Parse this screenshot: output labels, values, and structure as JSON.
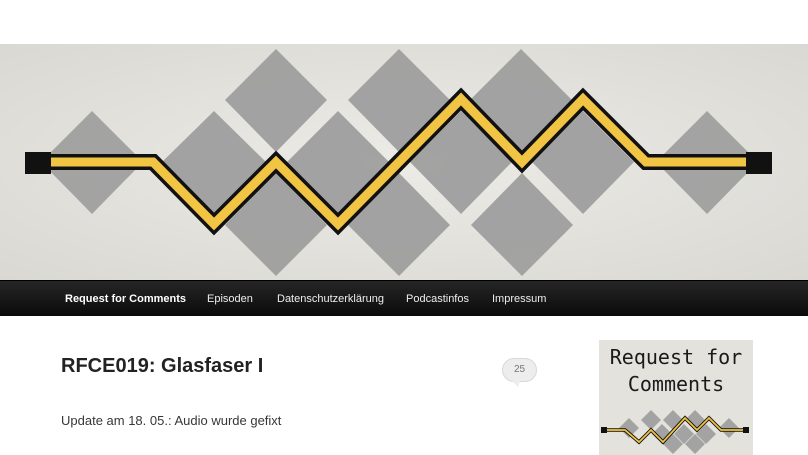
{
  "site": {
    "banner_alt": "Request for Comments header image",
    "colors": {
      "banner_background": "#e6e5e0",
      "diamond": "#9b9b9b",
      "zigzag_gold": "#f2c443",
      "zigzag_outline": "#111111",
      "navbar": "#141414",
      "nav_text": "#eeeeee"
    }
  },
  "nav": {
    "items": [
      {
        "label": "Request for Comments",
        "current": true
      },
      {
        "label": "Episoden"
      },
      {
        "label": "Datenschutzerklärung"
      },
      {
        "label": "Podcastinfos"
      },
      {
        "label": "Impressum"
      }
    ]
  },
  "post": {
    "title": "RFCE019: Glasfaser I",
    "comment_count": "25",
    "comment_icon": "speech-bubble-icon",
    "excerpt": "Update am 18. 05.: Audio wurde gefixt"
  },
  "sidebar": {
    "logo_line1": "Request for",
    "logo_line2": "Comments"
  }
}
